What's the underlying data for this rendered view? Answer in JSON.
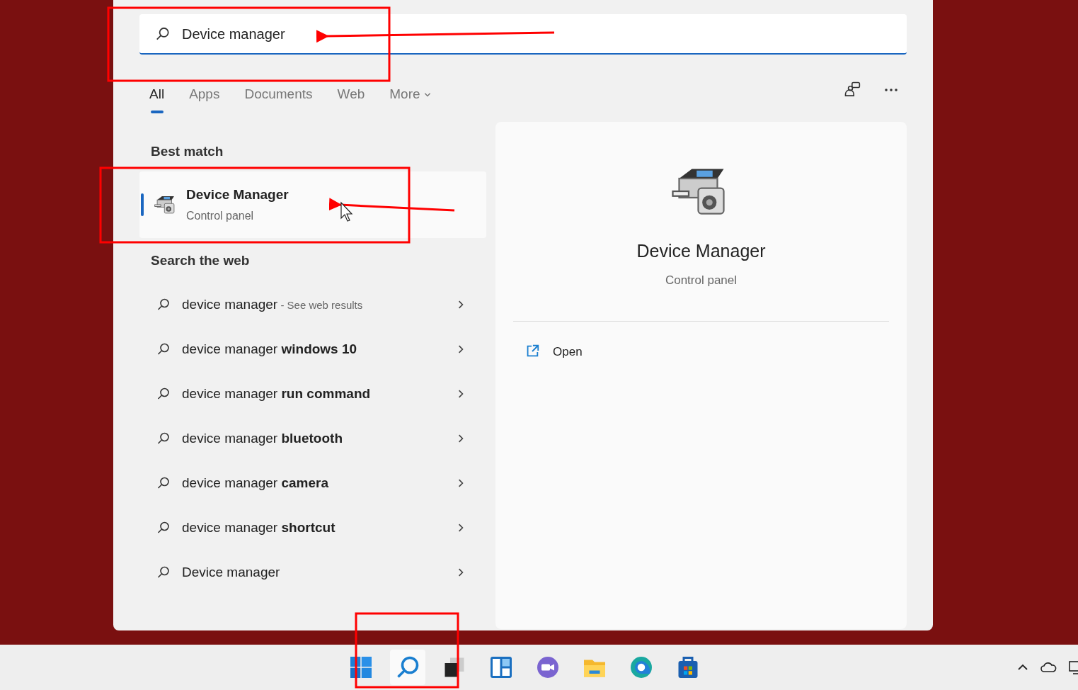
{
  "search": {
    "value": "Device manager"
  },
  "tabs": [
    {
      "label": "All",
      "selected": true
    },
    {
      "label": "Apps",
      "selected": false
    },
    {
      "label": "Documents",
      "selected": false
    },
    {
      "label": "Web",
      "selected": false
    },
    {
      "label": "More",
      "selected": false,
      "dropdown": true
    }
  ],
  "best_match": {
    "heading": "Best match",
    "title": "Device Manager",
    "subtitle": "Control panel",
    "selected": true
  },
  "web": {
    "heading": "Search the web",
    "items": [
      {
        "text": "device manager",
        "note": "- See web results"
      },
      {
        "text": "device manager **windows 10**"
      },
      {
        "text": "device manager **run command**"
      },
      {
        "text": "device manager **bluetooth**"
      },
      {
        "text": "device manager **camera**"
      },
      {
        "text": "device manager **shortcut**"
      },
      {
        "text": "Device manager"
      }
    ]
  },
  "preview": {
    "title": "Device Manager",
    "subtitle": "Control panel",
    "actions": [
      {
        "label": "Open"
      }
    ]
  }
}
